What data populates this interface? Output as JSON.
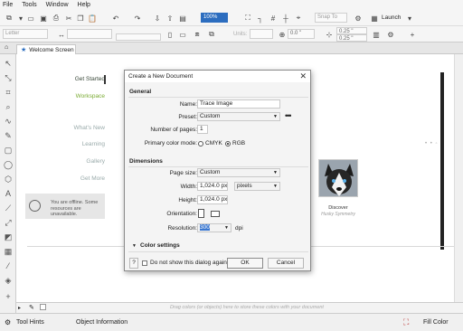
{
  "menu": [
    "File",
    "Tools",
    "Window",
    "Help"
  ],
  "toolbar": {
    "zoom_value": "100%",
    "snap_to": "Snap To",
    "launch": "Launch",
    "letter": "Letter",
    "units": "Units:",
    "angle": "0.0 \"",
    "nudge1": "0.25 \"",
    "nudge2": "0.25 \""
  },
  "tabs": {
    "welcome": "Welcome Screen"
  },
  "welcome_nav": {
    "get_started": "Get Started",
    "workspace": "Workspace",
    "whats_new": "What's New",
    "learning": "Learning",
    "gallery": "Gallery",
    "get_more": "Get More"
  },
  "offline_note": "You are offline. Some resources are unavailable.",
  "discover": {
    "title": "Discover",
    "subtitle": "Husky Symmetry"
  },
  "palette_hint": "Drag colors (or objects) here to store these colors with your document",
  "status": {
    "tool_hints": "Tool Hints",
    "object_info": "Object Information",
    "fill_color": "Fill Color"
  },
  "dialog": {
    "title": "Create a New Document",
    "general_heading": "General",
    "name_label": "Name:",
    "name_value": "Trace Image",
    "preset_label": "Preset:",
    "preset_value": "Custom",
    "pages_label": "Number of pages:",
    "pages_value": "1",
    "color_mode_label": "Primary color mode:",
    "cmyk": "CMYK",
    "rgb": "RGB",
    "dimensions_heading": "Dimensions",
    "page_size_label": "Page size:",
    "page_size_value": "Custom",
    "width_label": "Width:",
    "width_value": "1,024.0 px",
    "width_unit": "pixels",
    "height_label": "Height:",
    "height_value": "1,024.0 px",
    "orientation_label": "Orientation:",
    "resolution_label": "Resolution:",
    "resolution_value": "300",
    "resolution_unit": "dpi",
    "color_settings": "Color settings",
    "dont_show": "Do not show this dialog again",
    "ok": "OK",
    "cancel": "Cancel",
    "help": "?"
  }
}
